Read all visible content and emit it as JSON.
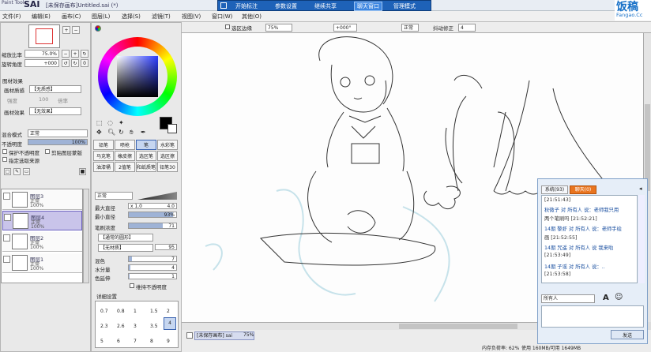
{
  "app": {
    "logo": "Paint Tool",
    "name": "SAI",
    "title": "[未保存画布]Untitled.sai (*)"
  },
  "menu": [
    "文件(F)",
    "编辑(E)",
    "画布(C)",
    "图层(L)",
    "选择(S)",
    "滤镜(T)",
    "视图(V)",
    "窗口(W)",
    "其他(O)"
  ],
  "overlay_toolbar": [
    "开始标注",
    "参数设置",
    "继续共享",
    "聊天窗口",
    "管理模式"
  ],
  "watermark": {
    "cn": "饭稿",
    "en": "Fangao.Cc"
  },
  "nav": {
    "zoom_label": "缩放比率",
    "zoom_value": "75.0%",
    "angle_label": "旋转角度",
    "angle_value": "+000"
  },
  "texture": {
    "title": "图材效果",
    "paper_label": "画材质感",
    "paper_value": "【无质感】",
    "effect_label": "画材效果",
    "effect_value": "【无效果】",
    "sub1": "强度",
    "sub2": "100",
    "sub3": "倍率"
  },
  "blend": {
    "label": "混合模式",
    "value": "正常",
    "opacity_label": "不透明度",
    "opacity_value": "100%"
  },
  "checks": [
    "保护不透明度",
    "剪贴图层蒙版",
    "指定选取来源"
  ],
  "layers": [
    {
      "name": "图层3",
      "mode": "正常",
      "opacity": "100%"
    },
    {
      "name": "图层4",
      "mode": "正常",
      "opacity": "100%"
    },
    {
      "name": "图层2",
      "mode": "正常",
      "opacity": "100%"
    },
    {
      "name": "图层1",
      "mode": "正常",
      "opacity": "100%"
    }
  ],
  "tools": [
    "铅笔",
    "喷枪",
    "笔",
    "水彩笔",
    "马克笔",
    "橡皮擦",
    "选区笔",
    "选区擦",
    "油漆桶",
    "2值笔",
    "和纸质笔",
    "铅笔30"
  ],
  "tool_settings": {
    "mode": "正常",
    "size_label": "最大直径",
    "size_mult": "x 1.0",
    "size_value": "4.0",
    "min_label": "最小直径",
    "min_value": "93%",
    "density_label": "笔刷浓度",
    "density_value": "71",
    "shape": "【通常的圆形】",
    "texture": "【无材质】",
    "texture_val": "95",
    "blend_label": "混色",
    "blend_value": "7",
    "water_label": "水分量",
    "water_value": "4",
    "keep_label": "色延伸",
    "keep_value": "1",
    "keep_opacity": "维持不透明度",
    "detail": "详细设置"
  },
  "brush_sizes": [
    "0.7",
    "0.8",
    "1",
    "1.5",
    "2",
    "2.3",
    "2.6",
    "3",
    "3.5",
    "4",
    "5",
    "6",
    "7",
    "8",
    "9"
  ],
  "canvas_toolbar": {
    "selection_edge": "选区边缘",
    "zoom": "75%",
    "angle": "+000°",
    "mode": "正常",
    "stabilizer_label": "抖动修正",
    "stabilizer_value": "4"
  },
  "status": {
    "file": "[未保存画布] sai",
    "zoom": "75%",
    "memory": "内存负荷率: 62%",
    "used": "使用 160MB/可用 1649MB"
  },
  "chat": {
    "tab1": "系统(93)",
    "tab2": "聊天(0)",
    "to": "所有人",
    "send": "发送",
    "lines": [
      "[21:51:43]",
      "秋微子 对 所有人 说：老师我只用",
      "两个笔刷吗 [21:52:21]",
      "14期 黎虾 对 所有人 说：老师手绘",
      "画 [21:52:55]",
      "14期 咒遥 对 所有人 说    我来啦",
      "[21:53:49]",
      "14期 子谣 对 所有人 说：..",
      "[21:53:58]"
    ]
  },
  "colors": {
    "accent": "#2f5ea8",
    "selected_layer": "#c9c4ea",
    "chat_tab": "#e9741f"
  }
}
